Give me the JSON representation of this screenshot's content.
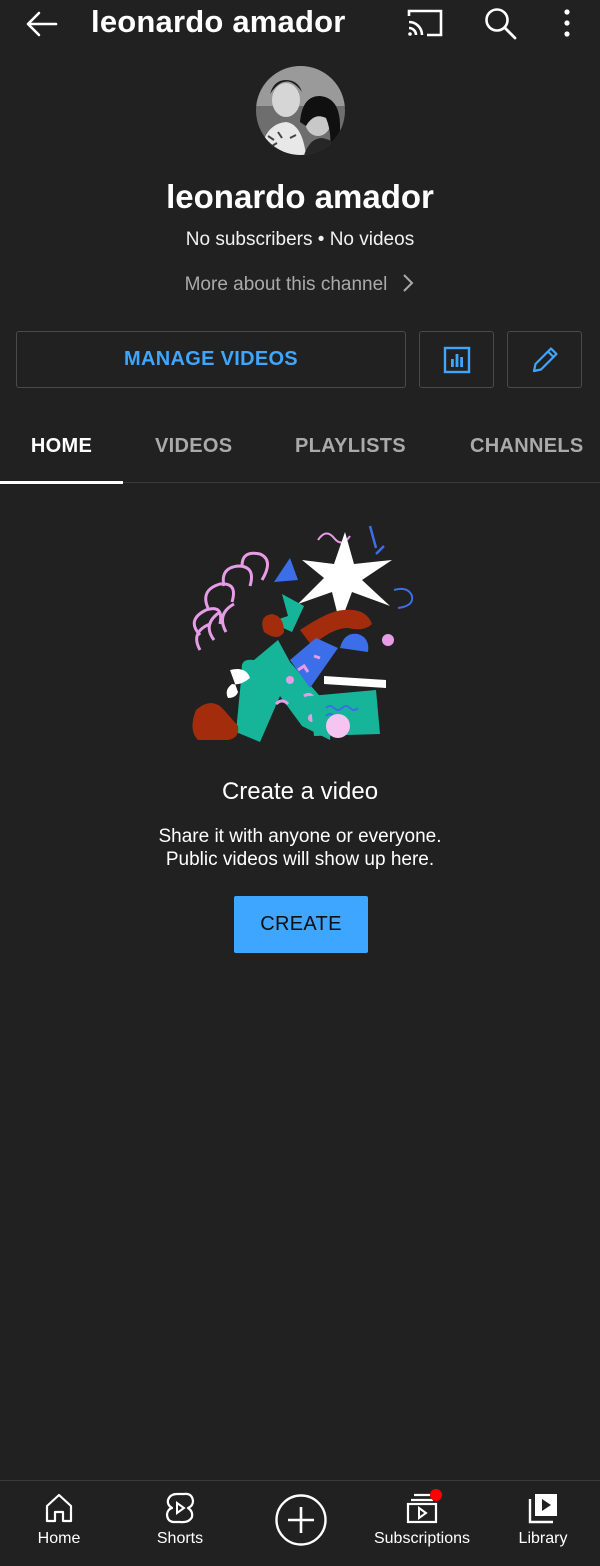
{
  "header": {
    "title": "leonardo amador",
    "icons": [
      "back-arrow-icon",
      "cast-icon",
      "search-icon",
      "more-vert-icon"
    ]
  },
  "channel": {
    "name": "leonardo amador",
    "stats": "No subscribers • No videos",
    "more_link": "More about this channel"
  },
  "actions": {
    "manage_label": "MANAGE VIDEOS",
    "icons": [
      "analytics-icon",
      "edit-pencil-icon"
    ],
    "accent_color": "#3ea6ff"
  },
  "tabs": [
    {
      "label": "HOME",
      "active": true
    },
    {
      "label": "VIDEOS",
      "active": false
    },
    {
      "label": "PLAYLISTS",
      "active": false
    },
    {
      "label": "CHANNELS",
      "active": false
    }
  ],
  "empty_state": {
    "title": "Create a video",
    "line1": "Share it with anyone or everyone.",
    "line2": "Public videos will show up here.",
    "button": "CREATE"
  },
  "bottom_nav": [
    {
      "label": "Home",
      "icon": "home-icon"
    },
    {
      "label": "Shorts",
      "icon": "shorts-icon"
    },
    {
      "label": "",
      "icon": "create-plus-icon"
    },
    {
      "label": "Subscriptions",
      "icon": "subscriptions-icon",
      "notification_dot": true
    },
    {
      "label": "Library",
      "icon": "library-icon"
    }
  ],
  "colors": {
    "background": "#212121",
    "accent": "#3ea6ff",
    "notification": "#ff0000"
  }
}
